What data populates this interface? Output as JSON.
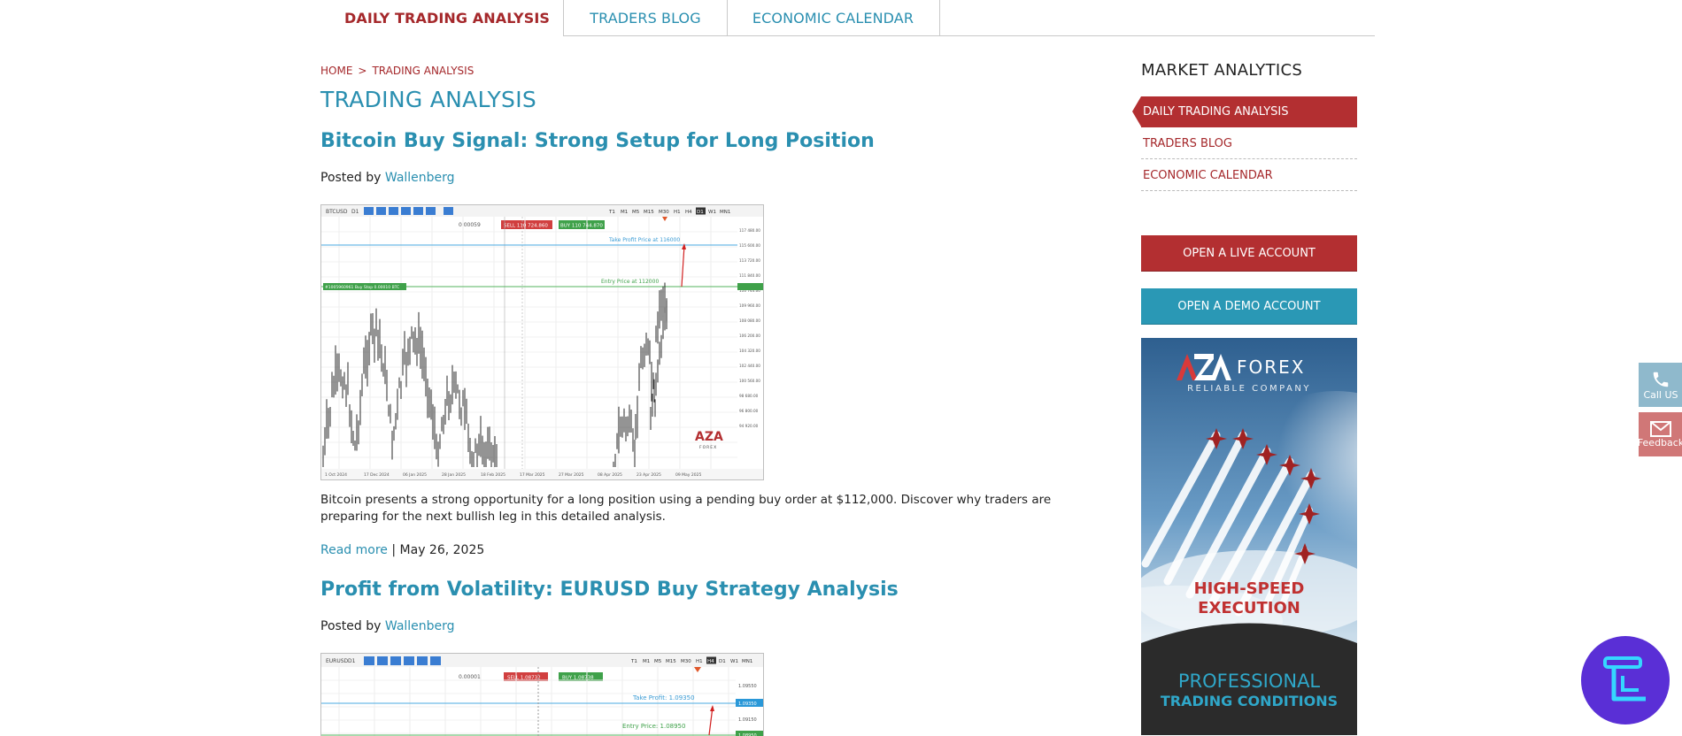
{
  "tabs": [
    {
      "label": "DAILY TRADING ANALYSIS"
    },
    {
      "label": "TRADERS BLOG"
    },
    {
      "label": "ECONOMIC CALENDAR"
    }
  ],
  "breadcrumb": {
    "home": "HOME",
    "separator": ">",
    "current": "TRADING ANALYSIS"
  },
  "page_title": "TRADING ANALYSIS",
  "posts": [
    {
      "title": "Bitcoin Buy Signal: Strong Setup for Long Position",
      "posted_by": "Posted by",
      "author": "Wallenberg",
      "excerpt": "Bitcoin presents a strong opportunity for a long position using a pending buy order at $112,000. Discover why traders are preparing for the next bullish leg in this detailed analysis.",
      "read_more": "Read more",
      "separator": "|",
      "date": "May 26, 2025",
      "chart": {
        "symbol": "BTCUSD",
        "timeframe": "D1",
        "spread": "0.00059",
        "sell": "SELL 110 724.860",
        "buy": "BUY 110 744.870",
        "take_profit_label": "Take Profit Price at 116000",
        "entry_label": "Entry Price at 112000",
        "order_label": "#1005960961 Buy Stop 0.00010 BTC",
        "timeframes": [
          "T1",
          "M1",
          "M5",
          "M15",
          "M30",
          "H1",
          "H4",
          "D1",
          "W1",
          "MN1"
        ],
        "dates": [
          "1 Oct 2024",
          "17 Dec 2024",
          "06 Jan 2025",
          "28 Jan 2025",
          "18 Feb 2025",
          "17 Mar 2025",
          "27 Mar 2025",
          "08 Apr 2025",
          "23 Apr 2025",
          "09 May 2025"
        ],
        "prices": [
          "117 480.00",
          "115 600.00",
          "113 720.00",
          "111 840.00",
          "110 744.00",
          "109 960.00",
          "108 080.00",
          "106 200.00",
          "104 320.00",
          "102 440.00",
          "100 560.00",
          "98 680.00",
          "96 800.00",
          "94 920.00"
        ],
        "logo": "AZA FOREX"
      }
    },
    {
      "title": "Profit from Volatility: EURUSD Buy Strategy Analysis",
      "posted_by": "Posted by",
      "author": "Wallenberg",
      "chart": {
        "symbol": "EURUSD",
        "timeframe": "D1",
        "spread": "0.00001",
        "sell": "SELL 1.08732",
        "buy": "BUY 1.08738",
        "take_profit_label": "Take Profit: 1.09350",
        "entry_label": "Entry Price: 1.08950",
        "timeframes": [
          "T1",
          "M1",
          "M5",
          "M15",
          "M30",
          "H1",
          "H4",
          "D1",
          "W1",
          "MN1"
        ],
        "prices": [
          "1.09550",
          "1.09350",
          "1.09150",
          "1.08950"
        ]
      }
    }
  ],
  "sidebar": {
    "title": "MARKET ANALYTICS",
    "items": [
      {
        "label": "DAILY TRADING ANALYSIS"
      },
      {
        "label": "TRADERS BLOG"
      },
      {
        "label": "ECONOMIC CALENDAR"
      }
    ],
    "live_button": "OPEN A LIVE ACCOUNT",
    "demo_button": "OPEN A DEMO ACCOUNT",
    "ad": {
      "logo_mark": "AZA",
      "logo_word": "FOREX",
      "tagline": "RELIABLE COMPANY",
      "headline_1": "HIGH-SPEED",
      "headline_2": "EXECUTION",
      "footer_1": "PROFESSIONAL",
      "footer_2": "TRADING CONDITIONS"
    }
  },
  "floating": {
    "call_label": "Call US",
    "feedback_label": "Feedback"
  },
  "colors": {
    "accent_red": "#a5282b",
    "accent_blue": "#2a8fb0",
    "badge_purple": "#5a2fd6"
  }
}
